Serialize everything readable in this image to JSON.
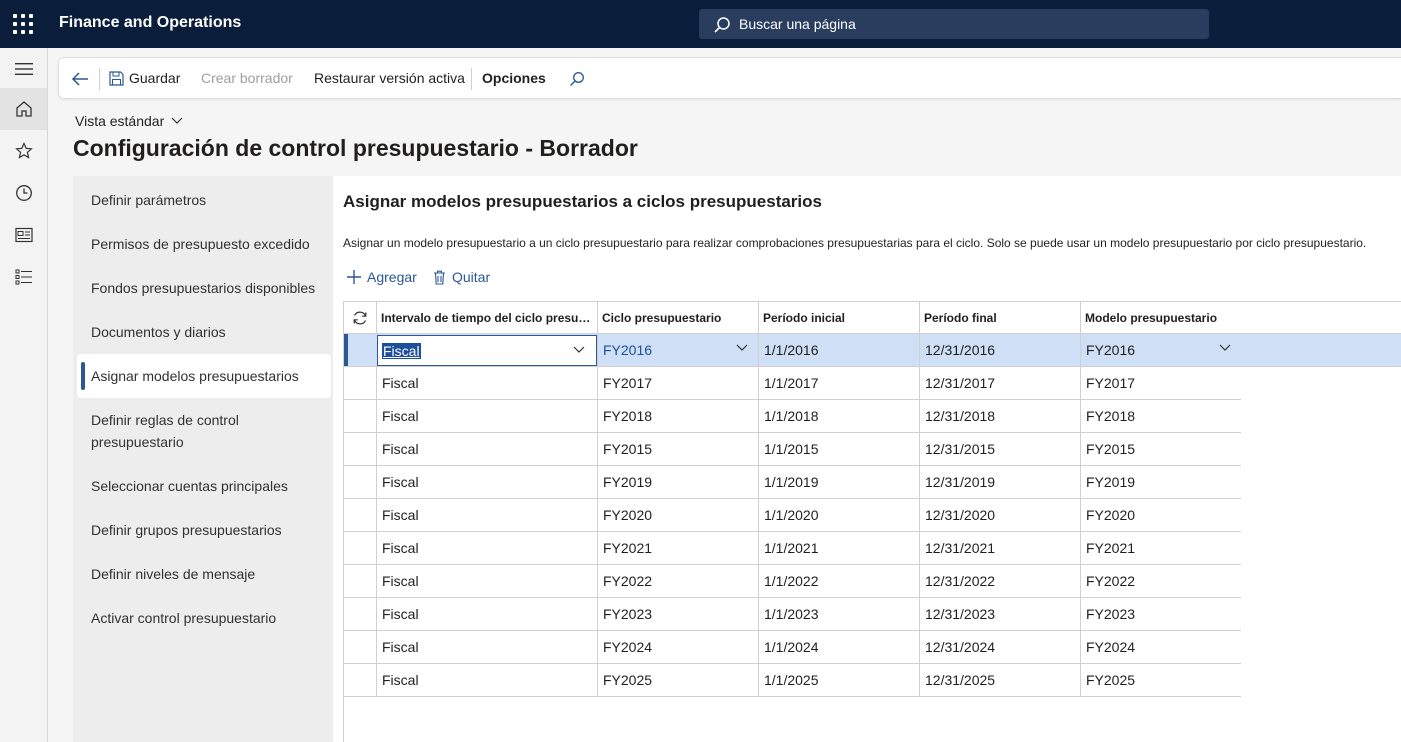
{
  "app": {
    "title": "Finance and Operations"
  },
  "search": {
    "placeholder": "Buscar una página"
  },
  "action_pane": {
    "save": "Guardar",
    "create_draft": "Crear borrador",
    "restore": "Restaurar versión activa",
    "options": "Opciones"
  },
  "view": {
    "label": "Vista estándar"
  },
  "page": {
    "title": "Configuración de control presupuestario - Borrador"
  },
  "steps": [
    "Definir parámetros",
    "Permisos de presupuesto excedido",
    "Fondos presupuestarios disponibles",
    "Documentos y diarios",
    "Asignar modelos presupuestarios",
    "Definir reglas de control presupuestario",
    "Seleccionar cuentas principales",
    "Definir grupos presupuestarios",
    "Definir niveles de mensaje",
    "Activar control presupuestario"
  ],
  "section": {
    "title": "Asignar modelos presupuestarios a ciclos presupuestarios",
    "description": "Asignar un modelo presupuestario a un ciclo presupuestario para realizar comprobaciones presupuestarias para el ciclo. Solo se puede usar un modelo presupuestario por ciclo presupuestario.",
    "add": "Agregar",
    "remove": "Quitar"
  },
  "grid": {
    "columns": [
      "Intervalo de tiempo del ciclo presupuestario",
      "Ciclo presupuestario",
      "Período inicial",
      "Período final",
      "Modelo presupuestario"
    ],
    "rows": [
      [
        "Fiscal",
        "FY2016",
        "1/1/2016",
        "12/31/2016",
        "FY2016"
      ],
      [
        "Fiscal",
        "FY2017",
        "1/1/2017",
        "12/31/2017",
        "FY2017"
      ],
      [
        "Fiscal",
        "FY2018",
        "1/1/2018",
        "12/31/2018",
        "FY2018"
      ],
      [
        "Fiscal",
        "FY2015",
        "1/1/2015",
        "12/31/2015",
        "FY2015"
      ],
      [
        "Fiscal",
        "FY2019",
        "1/1/2019",
        "12/31/2019",
        "FY2019"
      ],
      [
        "Fiscal",
        "FY2020",
        "1/1/2020",
        "12/31/2020",
        "FY2020"
      ],
      [
        "Fiscal",
        "FY2021",
        "1/1/2021",
        "12/31/2021",
        "FY2021"
      ],
      [
        "Fiscal",
        "FY2022",
        "1/1/2022",
        "12/31/2022",
        "FY2022"
      ],
      [
        "Fiscal",
        "FY2023",
        "1/1/2023",
        "12/31/2023",
        "FY2023"
      ],
      [
        "Fiscal",
        "FY2024",
        "1/1/2024",
        "12/31/2024",
        "FY2024"
      ],
      [
        "Fiscal",
        "FY2025",
        "1/1/2025",
        "12/31/2025",
        "FY2025"
      ]
    ]
  },
  "colors": {
    "topbar": "#0a1e3c",
    "accent": "#2b5797",
    "selected_row": "#cfdff5"
  }
}
